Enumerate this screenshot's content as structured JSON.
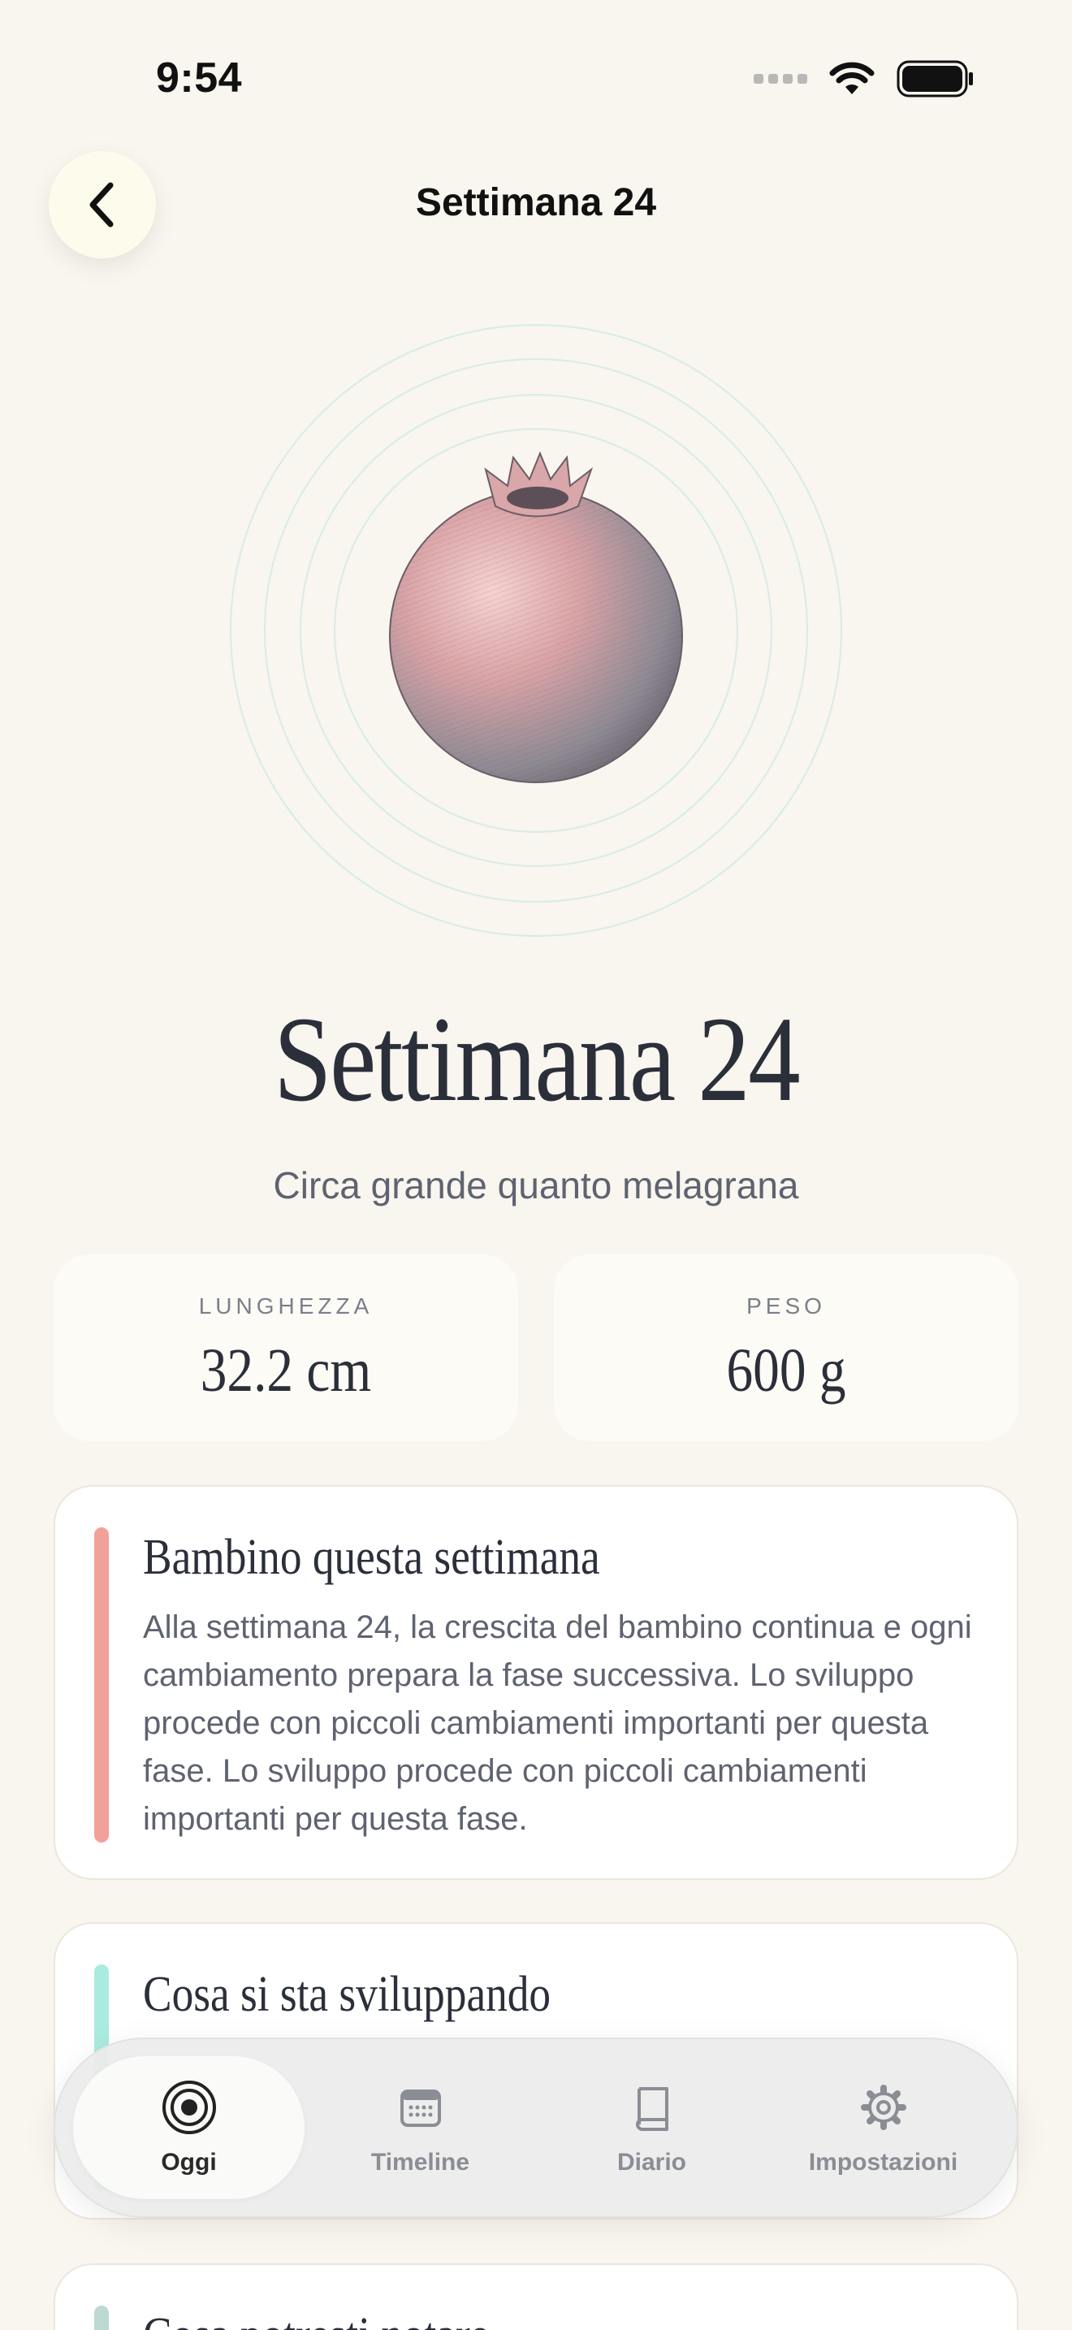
{
  "status_bar": {
    "time": "9:54"
  },
  "header": {
    "title": "Settimana 24"
  },
  "hero": {
    "fruit_icon": "pomegranate-illustration",
    "week_title": "Settimana 24",
    "size_comparison": "Circa grande quanto melagrana"
  },
  "stats": {
    "length": {
      "label": "LUNGHEZZA",
      "value": "32.2 cm"
    },
    "weight": {
      "label": "PESO",
      "value": "600 g"
    }
  },
  "cards": [
    {
      "title": "Bambino questa settimana",
      "body": "Alla settimana 24, la crescita del bambino continua e ogni cambiamento prepara la fase successiva. Lo sviluppo procede con piccoli cambiamenti importanti per questa fase. Lo sviluppo procede con piccoli cambiamenti importanti per questa fase.",
      "accent": "#f2a09a"
    },
    {
      "title": "Cosa si sta sviluppando",
      "accent": "#aaebdf"
    },
    {
      "title": "Cosa potresti notare",
      "accent": "#bcd9d3"
    }
  ],
  "tab_bar": {
    "tabs": [
      {
        "label": "Oggi",
        "icon": "target-icon",
        "active": true
      },
      {
        "label": "Timeline",
        "icon": "calendar-icon",
        "active": false
      },
      {
        "label": "Diario",
        "icon": "book-icon",
        "active": false
      },
      {
        "label": "Impostazioni",
        "icon": "gear-icon",
        "active": false
      }
    ]
  }
}
